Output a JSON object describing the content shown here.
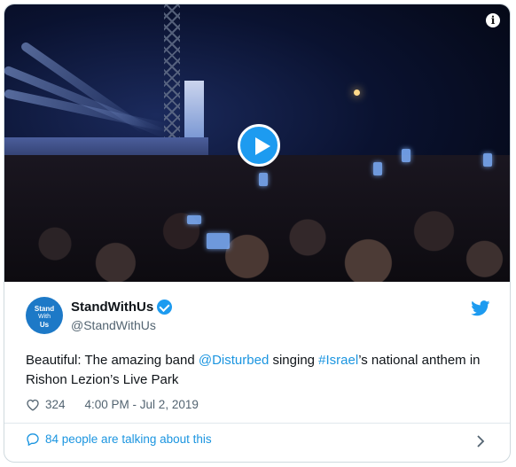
{
  "media": {
    "play_icon": "play-icon",
    "info_icon": "info-icon",
    "info_glyph": "i"
  },
  "author": {
    "avatar_line1": "Stand",
    "avatar_line2": "With",
    "avatar_line3": "Us",
    "display_name": "StandWithUs",
    "handle": "@StandWithUs",
    "verified_icon": "verified-badge-icon",
    "brand_icon": "twitter-bird-icon"
  },
  "tweet": {
    "text_part1": "Beautiful: The amazing band ",
    "mention": "@Disturbed",
    "text_part2": " singing ",
    "hashtag": "#Israel",
    "text_part3": "’s national anthem in Rishon Lezion’s Live Park"
  },
  "meta": {
    "like_count": "324",
    "timestamp": "4:00 PM - Jul 2, 2019"
  },
  "footer": {
    "talking_label": "84 people are talking about this"
  },
  "colors": {
    "accent": "#1b95e0",
    "verified": "#1d9bf0",
    "text": "#0f1419",
    "muted": "#536471"
  }
}
